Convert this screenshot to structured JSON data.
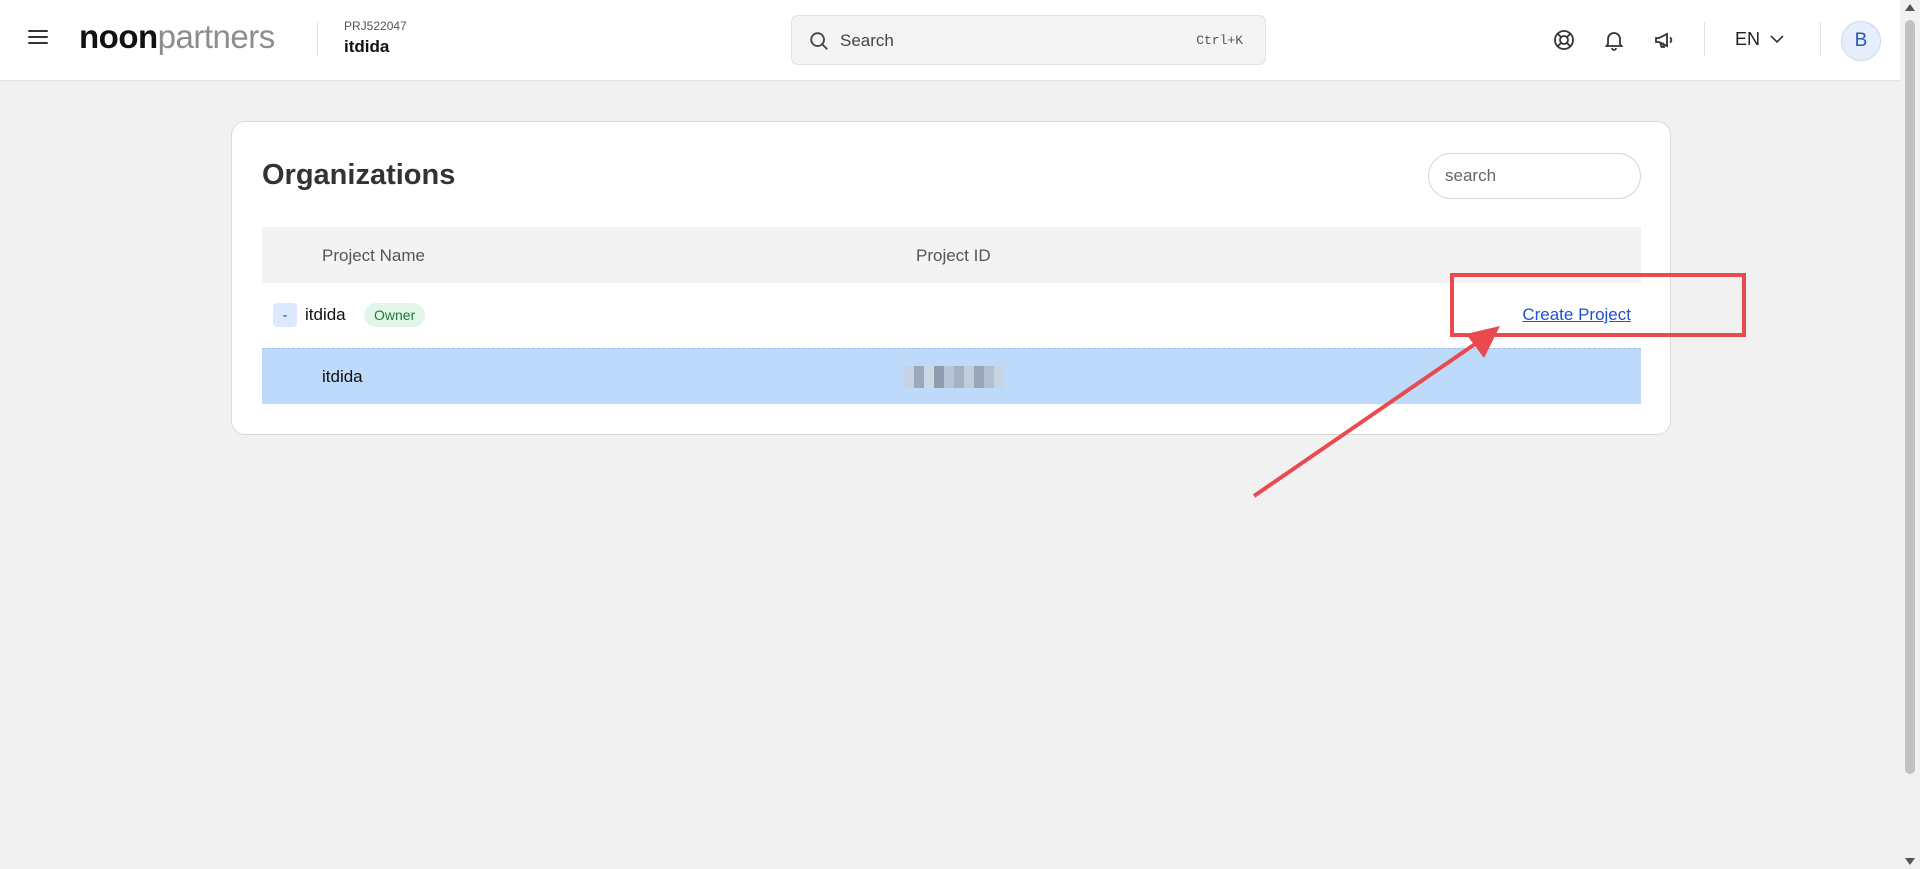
{
  "header": {
    "logo_bold": "noon",
    "logo_light": "partners",
    "project_id": "PRJ522047",
    "project_name": "itdida",
    "search_placeholder": "Search",
    "search_shortcut": "Ctrl+K",
    "language": "EN",
    "avatar_initial": "B"
  },
  "organizations": {
    "title": "Organizations",
    "search_placeholder": "search",
    "columns": [
      "Project Name",
      "Project ID"
    ],
    "org": {
      "toggle": "-",
      "name": "itdida",
      "role": "Owner",
      "create_link": "Create Project"
    },
    "projects": [
      {
        "name": "itdida"
      }
    ]
  },
  "colors": {
    "accent": "#1d4fd8",
    "selected_row": "#bedafb",
    "annotation": "#e84a4f"
  }
}
